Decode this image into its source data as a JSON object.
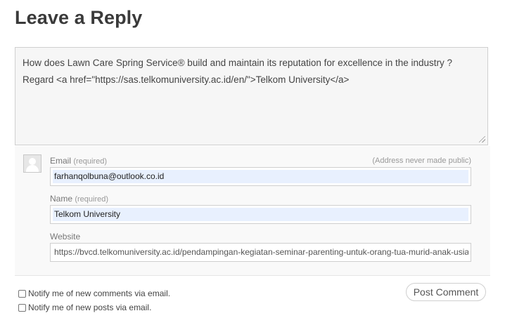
{
  "heading": "Leave a Reply",
  "comment": {
    "line1": "How does Lawn Care Spring Service® build and maintain its reputation for excellence in the industry ?",
    "line2": "Regard <a href=\"https://sas.telkomuniversity.ac.id/en/\">Telkom University</a>"
  },
  "form": {
    "avatar_icon": "avatar-placeholder-icon",
    "email": {
      "label": "Email",
      "required": "(required)",
      "note": "(Address never made public)",
      "value": "farhanqolbuna@outlook.co.id"
    },
    "name": {
      "label": "Name",
      "required": "(required)",
      "value": "Telkom University"
    },
    "website": {
      "label": "Website",
      "value": "https://bvcd.telkomuniversity.ac.id/pendampingan-kegiatan-seminar-parenting-untuk-orang-tua-murid-anak-usia"
    }
  },
  "options": {
    "notify_comments": "Notify me of new comments via email.",
    "notify_posts": "Notify me of new posts via email."
  },
  "submit_label": "Post Comment",
  "colors": {
    "autofill": "#e8f0fe",
    "panel": "#f9f9f9",
    "textarea": "#f6f6f6"
  }
}
